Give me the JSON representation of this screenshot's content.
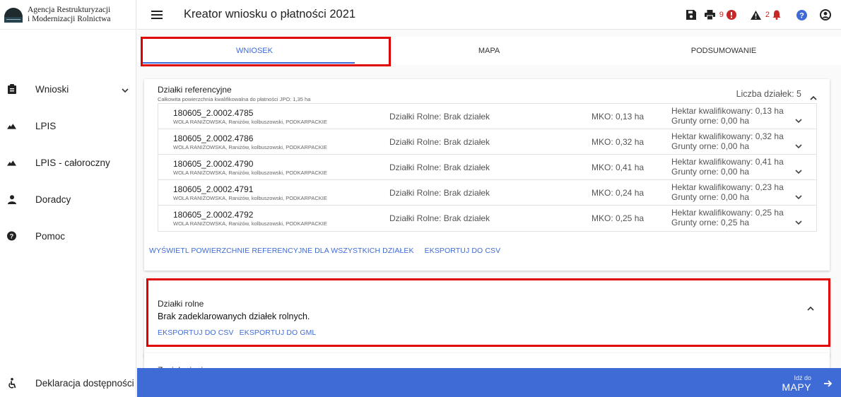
{
  "brand": {
    "line1": "Agencja Restrukturyzacji",
    "line2": "i Modernizacji Rolnictwa"
  },
  "sidebar": {
    "items": [
      {
        "label": "Wnioski",
        "icon": "clipboard-icon",
        "expandable": true
      },
      {
        "label": "LPIS",
        "icon": "terrain-icon"
      },
      {
        "label": "LPIS - całoroczny",
        "icon": "terrain-icon"
      },
      {
        "label": "Doradcy",
        "icon": "person-icon"
      },
      {
        "label": "Pomoc",
        "icon": "help-circle-icon"
      }
    ],
    "bottom": {
      "label": "Deklaracja dostępności",
      "icon": "accessibility-icon"
    }
  },
  "header": {
    "title": "Kreator wniosku o płatności 2021",
    "errors_count": "9",
    "warnings_count": "2",
    "colors": {
      "error": "#c62828",
      "accent": "#3f6bd6"
    }
  },
  "tabs": [
    {
      "label": "WNIOSEK",
      "active": true
    },
    {
      "label": "MAPA",
      "active": false
    },
    {
      "label": "PODSUMOWANIE",
      "active": false
    }
  ],
  "ref": {
    "title": "Działki referencyjne",
    "subtitle": "Całkowita powierzchnia kwalifikowalna do płatności JPO: 1,35 ha",
    "count_label": "Liczba działek: 5",
    "rows": [
      {
        "id": "180605_2.0002.4785",
        "loc": "WOLA RANIŻOWSKA, Raniżów, kolbuszowski, PODKARPACKIE",
        "rolne": "Działki Rolne: Brak działek",
        "mko": "MKO: 0,13 ha",
        "hektar": "Hektar kwalifikowany: 0,13 ha",
        "grunty": "Grunty orne: 0,00 ha"
      },
      {
        "id": "180605_2.0002.4786",
        "loc": "WOLA RANIŻOWSKA, Raniżów, kolbuszowski, PODKARPACKIE",
        "rolne": "Działki Rolne: Brak działek",
        "mko": "MKO: 0,32 ha",
        "hektar": "Hektar kwalifikowany: 0,32 ha",
        "grunty": "Grunty orne: 0,00 ha"
      },
      {
        "id": "180605_2.0002.4790",
        "loc": "WOLA RANIŻOWSKA, Raniżów, kolbuszowski, PODKARPACKIE",
        "rolne": "Działki Rolne: Brak działek",
        "mko": "MKO: 0,41 ha",
        "hektar": "Hektar kwalifikowany: 0,41 ha",
        "grunty": "Grunty orne: 0,00 ha"
      },
      {
        "id": "180605_2.0002.4791",
        "loc": "WOLA RANIŻOWSKA, Raniżów, kolbuszowski, PODKARPACKIE",
        "rolne": "Działki Rolne: Brak działek",
        "mko": "MKO: 0,24 ha",
        "hektar": "Hektar kwalifikowany: 0,23 ha",
        "grunty": "Grunty orne: 0,00 ha"
      },
      {
        "id": "180605_2.0002.4792",
        "loc": "WOLA RANIŻOWSKA, Raniżów, kolbuszowski, PODKARPACKIE",
        "rolne": "Działki Rolne: Brak działek",
        "mko": "MKO: 0,25 ha",
        "hektar": "Hektar kwalifikowany: 0,25 ha",
        "grunty": "Grunty orne: 0,25 ha"
      }
    ],
    "link_show": "WYŚWIETL POWIERZCHNIE REFERENCYJNE DLA WSZYSTKICH DZIAŁEK",
    "link_csv": "EKSPORTUJ DO CSV"
  },
  "rolne": {
    "title": "Działki rolne",
    "empty": "Brak zadeklarowanych działek rolnych.",
    "link_csv": "EKSPORTUJ DO CSV",
    "link_gml": "EKSPORTUJ DO GML"
  },
  "next_section": {
    "title": "Zazielenienie"
  },
  "footer": {
    "small": "Idź do",
    "big": "MAPY"
  }
}
